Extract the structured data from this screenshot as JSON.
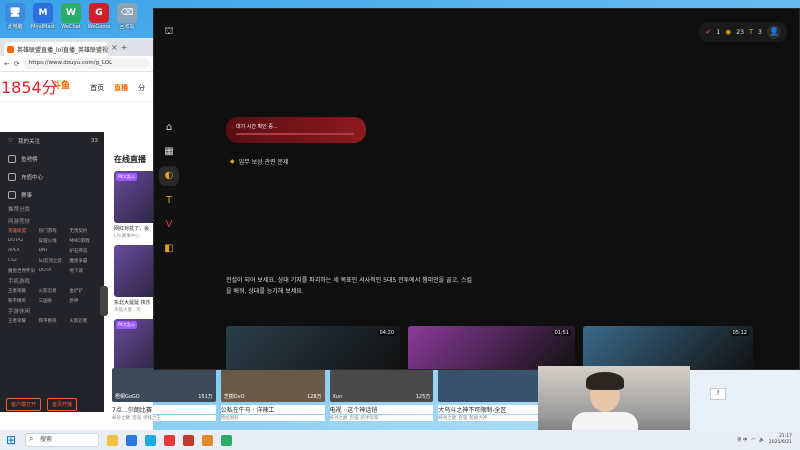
{
  "desktop": {
    "icons": [
      {
        "label": "此电脑",
        "color": "#3c8be0",
        "glyph": "🖥"
      },
      {
        "label": "MindMaster思维导图",
        "color": "#2d6fe0",
        "glyph": "M"
      },
      {
        "label": "WeChat",
        "color": "#2aae67",
        "glyph": "W"
      },
      {
        "label": "WeGame",
        "color": "#d0202a",
        "glyph": "G"
      },
      {
        "label": "回收站",
        "color": "#8aa3b8",
        "glyph": "⌫"
      }
    ]
  },
  "browser": {
    "tab_title": "英雄联盟直播_lol直播_英雄联盟视频",
    "tab_close": "×",
    "tab_new": "+",
    "url": "https://www.douyu.com/g_LOL",
    "overlay_number": "1854分",
    "logo_text": "斗鱼",
    "nav": [
      "首页",
      "直播",
      "分"
    ],
    "nav_active": 1,
    "sidebar": {
      "user_row": {
        "label": "我的关注",
        "count": "33"
      },
      "rows": [
        "鱼吧榜",
        "充值中心",
        "赛事"
      ],
      "section1": "推荐分类",
      "section2": "网游竞技",
      "games1": [
        "英雄联盟",
        "热门游戏",
        "无畏契约",
        "DOTA2",
        "穿越火线",
        "MMO游戏",
        "APEX",
        "DNF",
        "炉石传说",
        "CS2",
        "lol云顶之弈",
        "魔兽争霸",
        "魔兽世界怀旧",
        "DOTA",
        "地下城"
      ],
      "section3": "手机游戏",
      "games2": [
        "王者荣耀",
        "火影忍者",
        "金铲铲",
        "和平精英",
        "三国杀",
        "原神"
      ],
      "section4": "手游休闲",
      "games3": [
        "王者荣耀",
        "和平精英",
        "火影忍者"
      ],
      "btn_left": "客户端打开",
      "btn_right": "首页开播"
    },
    "section_title": "在线直播",
    "cards": [
      {
        "pill": "PK大乱斗",
        "title": "网红对抗了，会",
        "sub": "LPL赛事中心"
      },
      {
        "pill": "",
        "title": "东北大鼠鼠 快乐",
        "sub": "英雄大厦 · 荣"
      },
      {
        "pill": "PK大乱斗",
        "title": "",
        "sub": ""
      }
    ]
  },
  "streams": [
    {
      "name": "梧桐GoGO",
      "hot": "151万",
      "title": "7点…尔朗比赛",
      "tags": [
        "峡谷之巅",
        "百强",
        "单排之王"
      ],
      "color": "#3c4a58"
    },
    {
      "name": "芝樹OvO",
      "hot": "128万",
      "title": "公私在牛马 · 洋辣工",
      "tags": [
        "哈哈真好"
      ],
      "color": "#6b5a48"
    },
    {
      "name": "Xun",
      "hot": "125万",
      "title": "电视 · 这个神话铠",
      "tags": [
        "峡谷之巅",
        "百强",
        "新手玩家"
      ],
      "color": "#4a4a4a"
    },
    {
      "name": "",
      "hot": "",
      "title": "大乌斗之神不可限制-全区",
      "tags": [
        "峡谷之巅",
        "百强",
        "超级大神"
      ],
      "color": "#38526b"
    }
  ],
  "riot": {
    "top": {
      "ranked": "1",
      "coins": "23",
      "tokens": "3"
    },
    "loading_text": "대기 시간 확인 중...",
    "mission_text": "임무 보상 관련 문제",
    "tagline": "전설이 되어 보세요. 상대 기지를 파괴하는 세 목표인 서사적인 5대5 전투에서 챔피언을 골고, 스킬을 배워, 상대를 능가해 보세요.",
    "thumbs": [
      {
        "duration": "04:20",
        "color": "#2a3e4a",
        "w": 174
      },
      {
        "duration": "01:51",
        "color": "#8a3a9a",
        "w": 167
      },
      {
        "duration": "05:12",
        "color": "#3a6a8a",
        "w": 170
      }
    ]
  },
  "right_panel": {
    "button": "?"
  },
  "taskbar": {
    "start_glyph": "⊞",
    "search": "搜索",
    "app_colors": [
      "#f0c040",
      "#2a7ae2",
      "#1da8e8",
      "#e23b3b",
      "#c23a2a",
      "#e08a2a",
      "#2aae67"
    ],
    "tray": "英 中",
    "time": "21:17",
    "date": "2025/6/21"
  }
}
